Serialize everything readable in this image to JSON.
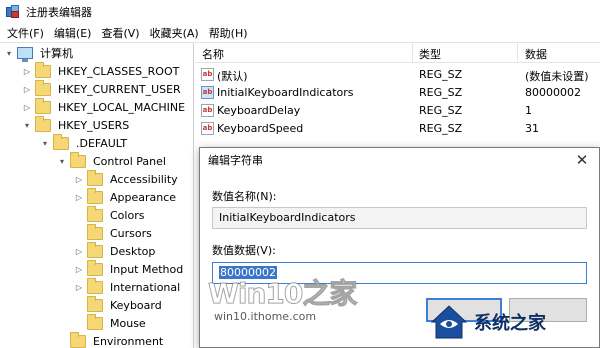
{
  "window": {
    "title": "注册表编辑器",
    "icon": "regedit-icon"
  },
  "menu": [
    "文件(F)",
    "编辑(E)",
    "查看(V)",
    "收藏夹(A)",
    "帮助(H)"
  ],
  "tree": {
    "computer": "计算机",
    "roots": [
      "HKEY_CLASSES_ROOT",
      "HKEY_CURRENT_USER",
      "HKEY_LOCAL_MACHINE",
      "HKEY_USERS"
    ],
    "default": ".DEFAULT",
    "control_panel": "Control Panel",
    "children": [
      "Accessibility",
      "Appearance",
      "Colors",
      "Cursors",
      "Desktop",
      "Input Method",
      "International",
      "Keyboard",
      "Mouse"
    ],
    "environment": "Environment",
    "selected": "Keyboard"
  },
  "list": {
    "columns": [
      "名称",
      "类型",
      "数据"
    ],
    "rows": [
      {
        "name": "(默认)",
        "type": "REG_SZ",
        "data": "(数值未设置)",
        "icon": "ab-string-icon"
      },
      {
        "name": "InitialKeyboardIndicators",
        "type": "REG_SZ",
        "data": "80000002",
        "icon": "ab-string-icon"
      },
      {
        "name": "KeyboardDelay",
        "type": "REG_SZ",
        "data": "1",
        "icon": "ab-string-icon"
      },
      {
        "name": "KeyboardSpeed",
        "type": "REG_SZ",
        "data": "31",
        "icon": "ab-string-icon"
      }
    ]
  },
  "dialog": {
    "title": "编辑字符串",
    "name_label": "数值名称(N):",
    "name_value": "InitialKeyboardIndicators",
    "data_label": "数值数据(V):",
    "data_value": "80000002",
    "close_glyph": "✕"
  },
  "watermarks": {
    "win10_brand": "Win10之家",
    "win10_url": "win10.ithome.com",
    "xitong": "系统之家"
  },
  "colors": {
    "selection": "#3b76c9",
    "folder": "#f6d776",
    "accent_border": "#3c7fd6"
  }
}
